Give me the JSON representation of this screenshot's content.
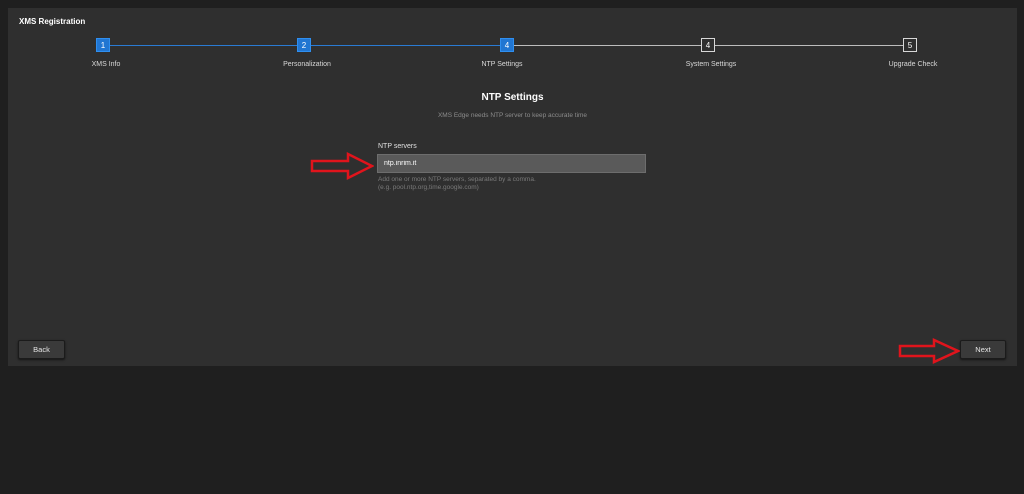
{
  "window": {
    "title": "XMS Registration"
  },
  "steps": [
    {
      "number": "1",
      "label": "XMS Info",
      "state": "done"
    },
    {
      "number": "2",
      "label": "Personalization",
      "state": "done"
    },
    {
      "number": "4",
      "label": "NTP Settings",
      "state": "current"
    },
    {
      "number": "4",
      "label": "System Settings",
      "state": "todo"
    },
    {
      "number": "5",
      "label": "Upgrade Check",
      "state": "todo"
    }
  ],
  "page": {
    "heading": "NTP Settings",
    "subheading": "XMS Edge needs NTP server to keep accurate time"
  },
  "ntp": {
    "label": "NTP servers",
    "value": "ntp.inrim.it",
    "hint_line1": "Add one or more NTP servers, separated by a comma.",
    "hint_line2": "(e.g. pool.ntp.org,time.google.com)"
  },
  "buttons": {
    "back": "Back",
    "next": "Next"
  },
  "colors": {
    "accent": "#2176d2",
    "annotation_arrow": "#e0141c",
    "panel_bg": "#2f2f2f",
    "page_bg": "#1f1f1f"
  }
}
